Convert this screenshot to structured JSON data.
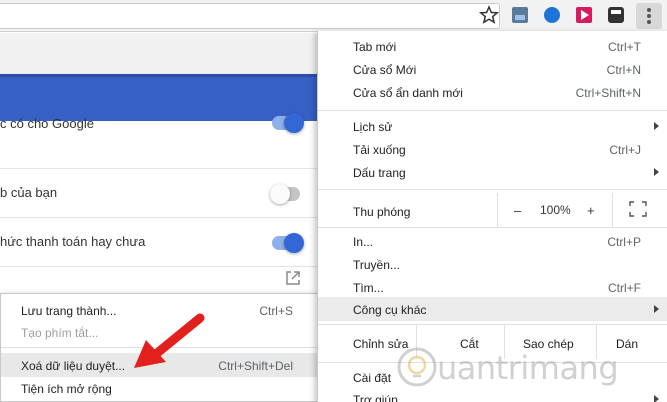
{
  "settings": {
    "rows": [
      {
        "text": "c có cho Google",
        "toggle": "on"
      },
      {
        "text": "b của bạn",
        "toggle": "off"
      },
      {
        "text": "hức thanh toán hay chưa",
        "toggle": "on"
      }
    ]
  },
  "submenu": {
    "items": [
      {
        "label": "Lưu trang thành...",
        "shortcut": "Ctrl+S",
        "enabled": true
      },
      {
        "label": "Tạo phím tắt...",
        "shortcut": "",
        "enabled": false
      },
      {
        "label": "Xoá dữ liệu duyệt...",
        "shortcut": "Ctrl+Shift+Del",
        "enabled": true,
        "highlighted": true
      },
      {
        "label": "Tiện ích mở rộng",
        "shortcut": "",
        "enabled": true
      }
    ]
  },
  "menu": {
    "new_tab": {
      "label": "Tab mới",
      "shortcut": "Ctrl+T"
    },
    "new_window": {
      "label": "Cửa sổ Mới",
      "shortcut": "Ctrl+N"
    },
    "incognito": {
      "label": "Cửa sổ ẩn danh mới",
      "shortcut": "Ctrl+Shift+N"
    },
    "history": {
      "label": "Lịch sử"
    },
    "downloads": {
      "label": "Tải xuống",
      "shortcut": "Ctrl+J"
    },
    "bookmarks": {
      "label": "Dấu trang"
    },
    "zoom": {
      "label": "Thu phóng",
      "minus": "–",
      "value": "100%",
      "plus": "+"
    },
    "print": {
      "label": "In...",
      "shortcut": "Ctrl+P"
    },
    "cast": {
      "label": "Truyền..."
    },
    "find": {
      "label": "Tìm...",
      "shortcut": "Ctrl+F"
    },
    "more_tools": {
      "label": "Công cụ khác"
    },
    "edit": {
      "label": "Chỉnh sửa",
      "cut": "Cắt",
      "copy": "Sao chép",
      "paste": "Dán"
    },
    "settings": {
      "label": "Cài đặt"
    },
    "help": {
      "label": "Trợ giúp"
    }
  },
  "watermark": {
    "text": "uantrimang"
  },
  "icons": {
    "star": "star-icon",
    "menu": "three-dots-icon",
    "fullscreen": "fullscreen-icon",
    "external": "external-link-icon",
    "submenu_arrow": "chevron-right-icon"
  },
  "colors": {
    "accent": "#3367d6",
    "header_band": "#3760c4",
    "annotation_arrow": "#e3211c"
  }
}
